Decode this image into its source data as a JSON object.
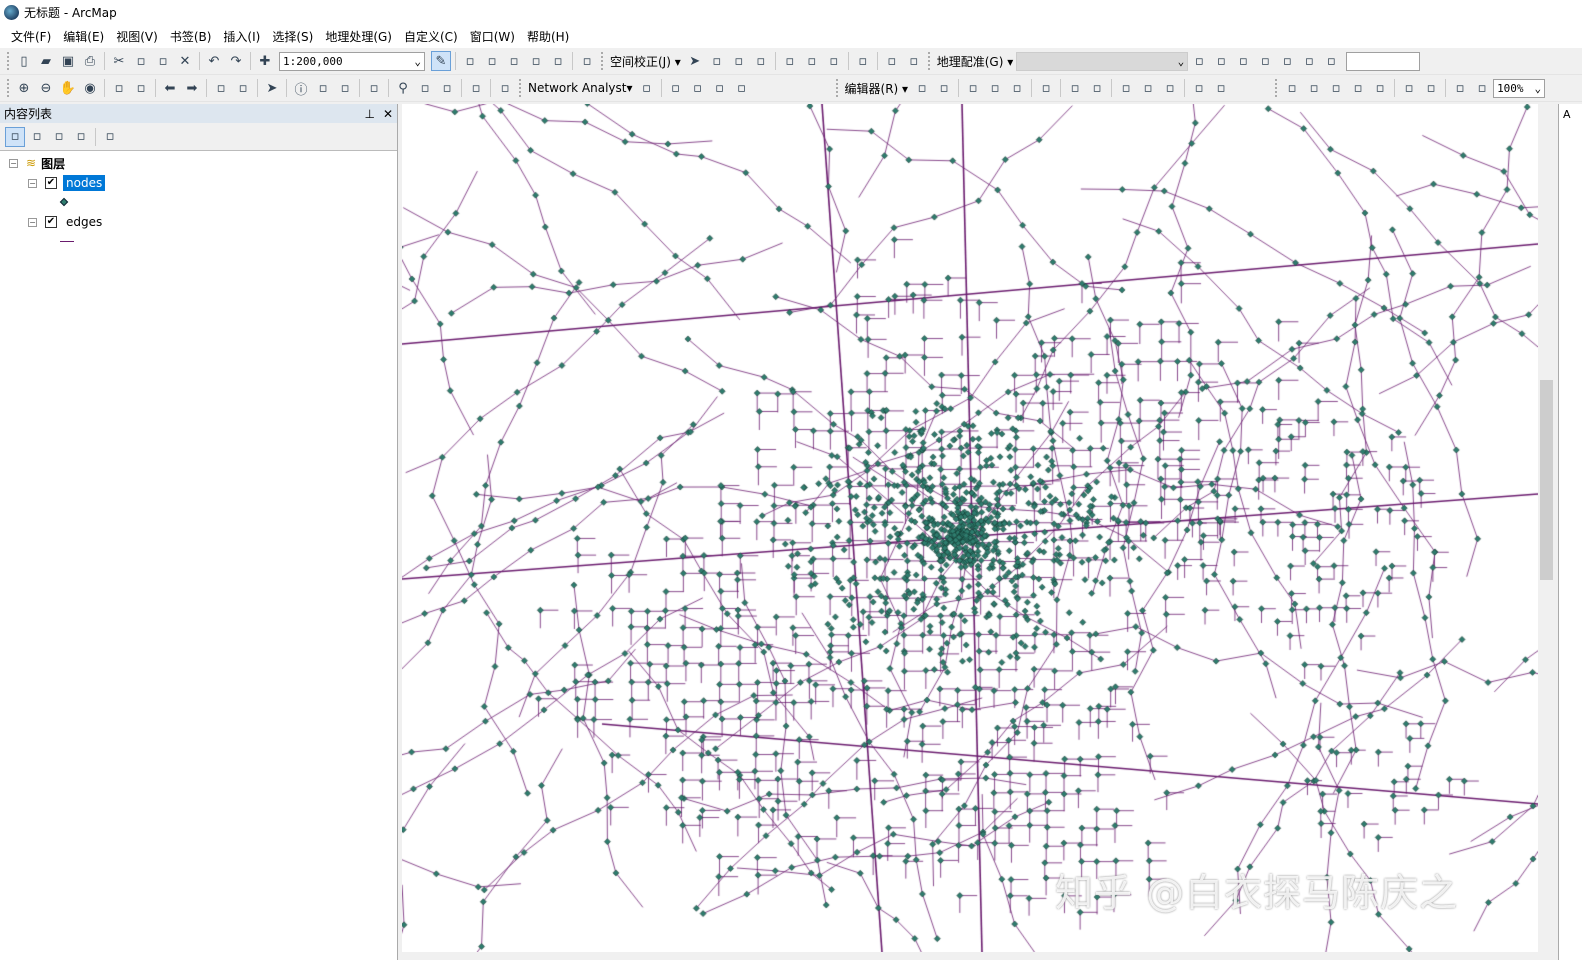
{
  "window": {
    "title": "无标题 - ArcMap"
  },
  "menu": [
    "文件(F)",
    "编辑(E)",
    "视图(V)",
    "书签(B)",
    "插入(I)",
    "选择(S)",
    "地理处理(G)",
    "自定义(C)",
    "窗口(W)",
    "帮助(H)"
  ],
  "toolbar1": {
    "icons_a": [
      "new-document-icon",
      "open-folder-icon",
      "save-icon",
      "print-icon",
      "|",
      "cut-icon",
      "copy-icon",
      "paste-icon",
      "delete-icon",
      "|",
      "undo-icon",
      "redo-icon",
      "|",
      "add-data-icon"
    ],
    "scale": "1:200,000",
    "icons_b": [
      "editor-toolbar-icon",
      "|",
      "toc-window-icon",
      "catalog-icon",
      "search-window-icon",
      "arctoolbox-icon",
      "python-window-icon",
      "|",
      "model-builder-icon"
    ],
    "spatial_adjustment": "空间校正(J)",
    "icons_c": [
      "select-elements-icon",
      "new-displacement-link-icon",
      "modify-link-icon",
      "limited-adjust-icon",
      "|",
      "view-link-table-icon",
      "adjust-icon",
      "attribute-transfer-icon",
      "|",
      "identity-link-icon",
      "|",
      "multi-displacement-icon",
      "new-limited-area-icon"
    ],
    "georeferencing": "地理配准(G)",
    "icons_d": [
      "add-control-points-icon",
      "fit-to-display-icon",
      "rotate-icon",
      "shift-icon",
      "view-link-table-icon",
      "auto-registration-icon",
      "rotate-dropdown-icon"
    ]
  },
  "toolbar2": {
    "icons_a": [
      "zoom-in-icon",
      "zoom-out-icon",
      "pan-icon",
      "full-extent-icon",
      "|",
      "fixed-zoom-in-icon",
      "fixed-zoom-out-icon",
      "|",
      "back-icon",
      "forward-icon",
      "|",
      "select-features-icon",
      "clear-selection-icon",
      "|",
      "select-elements-icon",
      "|",
      "identify-icon",
      "hyperlink-icon",
      "html-popup-icon",
      "|",
      "measure-icon",
      "|",
      "find-icon",
      "find-route-icon",
      "goto-xy-icon",
      "|",
      "time-slider-icon",
      "|",
      "magnifier-icon"
    ],
    "network_analyst": "Network Analyst",
    "icons_b": [
      "network-analyst-window-icon",
      "|",
      "create-network-location-icon",
      "select-move-location-icon",
      "od-matrix-icon",
      "directions-icon"
    ],
    "editor": "编辑器(R)",
    "icons_c": [
      "edit-tool-icon",
      "edit-annotation-icon",
      "|",
      "straight-segment-icon",
      "endpoint-arc-icon",
      "construction-tools-icon",
      "|",
      "point-icon",
      "|",
      "topology-edit-icon",
      "split-icon",
      "|",
      "snap-icon",
      "cut-polygon-icon",
      "rotate-icon",
      "|",
      "attributes-icon",
      "sketch-properties-icon"
    ],
    "icons_d": [
      "layout-zoom-in-icon",
      "layout-zoom-out-icon",
      "layout-pan-icon",
      "zoom-whole-page-icon",
      "zoom-100-icon",
      "|",
      "fixed-zoom-in-icon",
      "fixed-zoom-out-icon",
      "|",
      "go-back-extent-icon",
      "go-forward-extent-icon"
    ],
    "zoom_percent": "100%"
  },
  "toc": {
    "title": "内容列表",
    "tools": [
      "list-by-drawing-order-icon",
      "list-by-source-icon",
      "list-by-visibility-icon",
      "list-by-selection-icon",
      "|",
      "options-icon"
    ],
    "root": "图层",
    "layers": [
      {
        "name": "nodes",
        "checked": true,
        "selected": true
      },
      {
        "name": "edges",
        "checked": true,
        "selected": false
      }
    ]
  },
  "right_panel": {
    "label": "A"
  },
  "watermark": "知乎 @白衣探马陈庆之",
  "colors": {
    "node": "#2e7d6e",
    "edge": "#6a1b6e",
    "selection": "#0078d7"
  }
}
